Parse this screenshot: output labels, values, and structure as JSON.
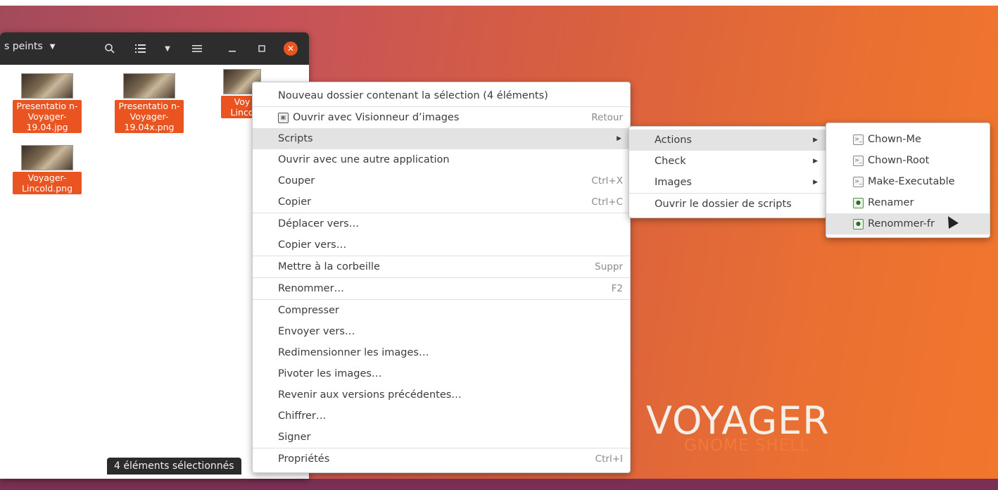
{
  "window": {
    "path_label": "s peints",
    "status": "4 éléments sélectionnés"
  },
  "files": [
    {
      "name": "Presentatio n-Voyager- 19.04.jpg"
    },
    {
      "name": "Presentatio n-Voyager- 19.04x.png"
    },
    {
      "name": "Voy Linco"
    },
    {
      "name": "Voyager- Lincold.png"
    }
  ],
  "context_menu": {
    "items": [
      {
        "label": "Nouveau dossier contenant la sélection (4 éléments)",
        "accel": ""
      },
      {
        "label": "Ouvrir avec Visionneur d’images",
        "accel": "Retour",
        "icon": "image-viewer-icon"
      },
      {
        "label": "Scripts",
        "accel": "",
        "submenu": true
      },
      {
        "label": "Ouvrir avec une autre application",
        "accel": ""
      },
      {
        "label": "Couper",
        "accel": "Ctrl+X"
      },
      {
        "label": "Copier",
        "accel": "Ctrl+C"
      },
      {
        "label": "Déplacer vers…",
        "accel": ""
      },
      {
        "label": "Copier vers…",
        "accel": ""
      },
      {
        "label": "Mettre à la corbeille",
        "accel": "Suppr"
      },
      {
        "label": "Renommer…",
        "accel": "F2"
      },
      {
        "label": "Compresser",
        "accel": ""
      },
      {
        "label": "Envoyer vers…",
        "accel": ""
      },
      {
        "label": "Redimensionner les images…",
        "accel": ""
      },
      {
        "label": "Pivoter les images…",
        "accel": ""
      },
      {
        "label": "Revenir aux versions précédentes…",
        "accel": ""
      },
      {
        "label": "Chiffrer…",
        "accel": ""
      },
      {
        "label": "Signer",
        "accel": ""
      },
      {
        "label": "Propriétés",
        "accel": "Ctrl+I"
      }
    ]
  },
  "scripts_menu": {
    "items": [
      {
        "label": "Actions",
        "submenu": true
      },
      {
        "label": "Check",
        "submenu": true
      },
      {
        "label": "Images",
        "submenu": true
      },
      {
        "label": "Ouvrir le dossier de scripts",
        "submenu": false
      }
    ]
  },
  "actions_menu": {
    "items": [
      {
        "label": "Chown-Me",
        "icon": "script-file-icon"
      },
      {
        "label": "Chown-Root",
        "icon": "script-file-icon"
      },
      {
        "label": "Make-Executable",
        "icon": "script-file-icon"
      },
      {
        "label": "Renamer",
        "icon": "python-file-icon"
      },
      {
        "label": "Renommer-fr",
        "icon": "python-file-icon"
      }
    ]
  },
  "wallpaper": {
    "title": "VOYAGER",
    "subtitle": "GNOME SHELL"
  }
}
